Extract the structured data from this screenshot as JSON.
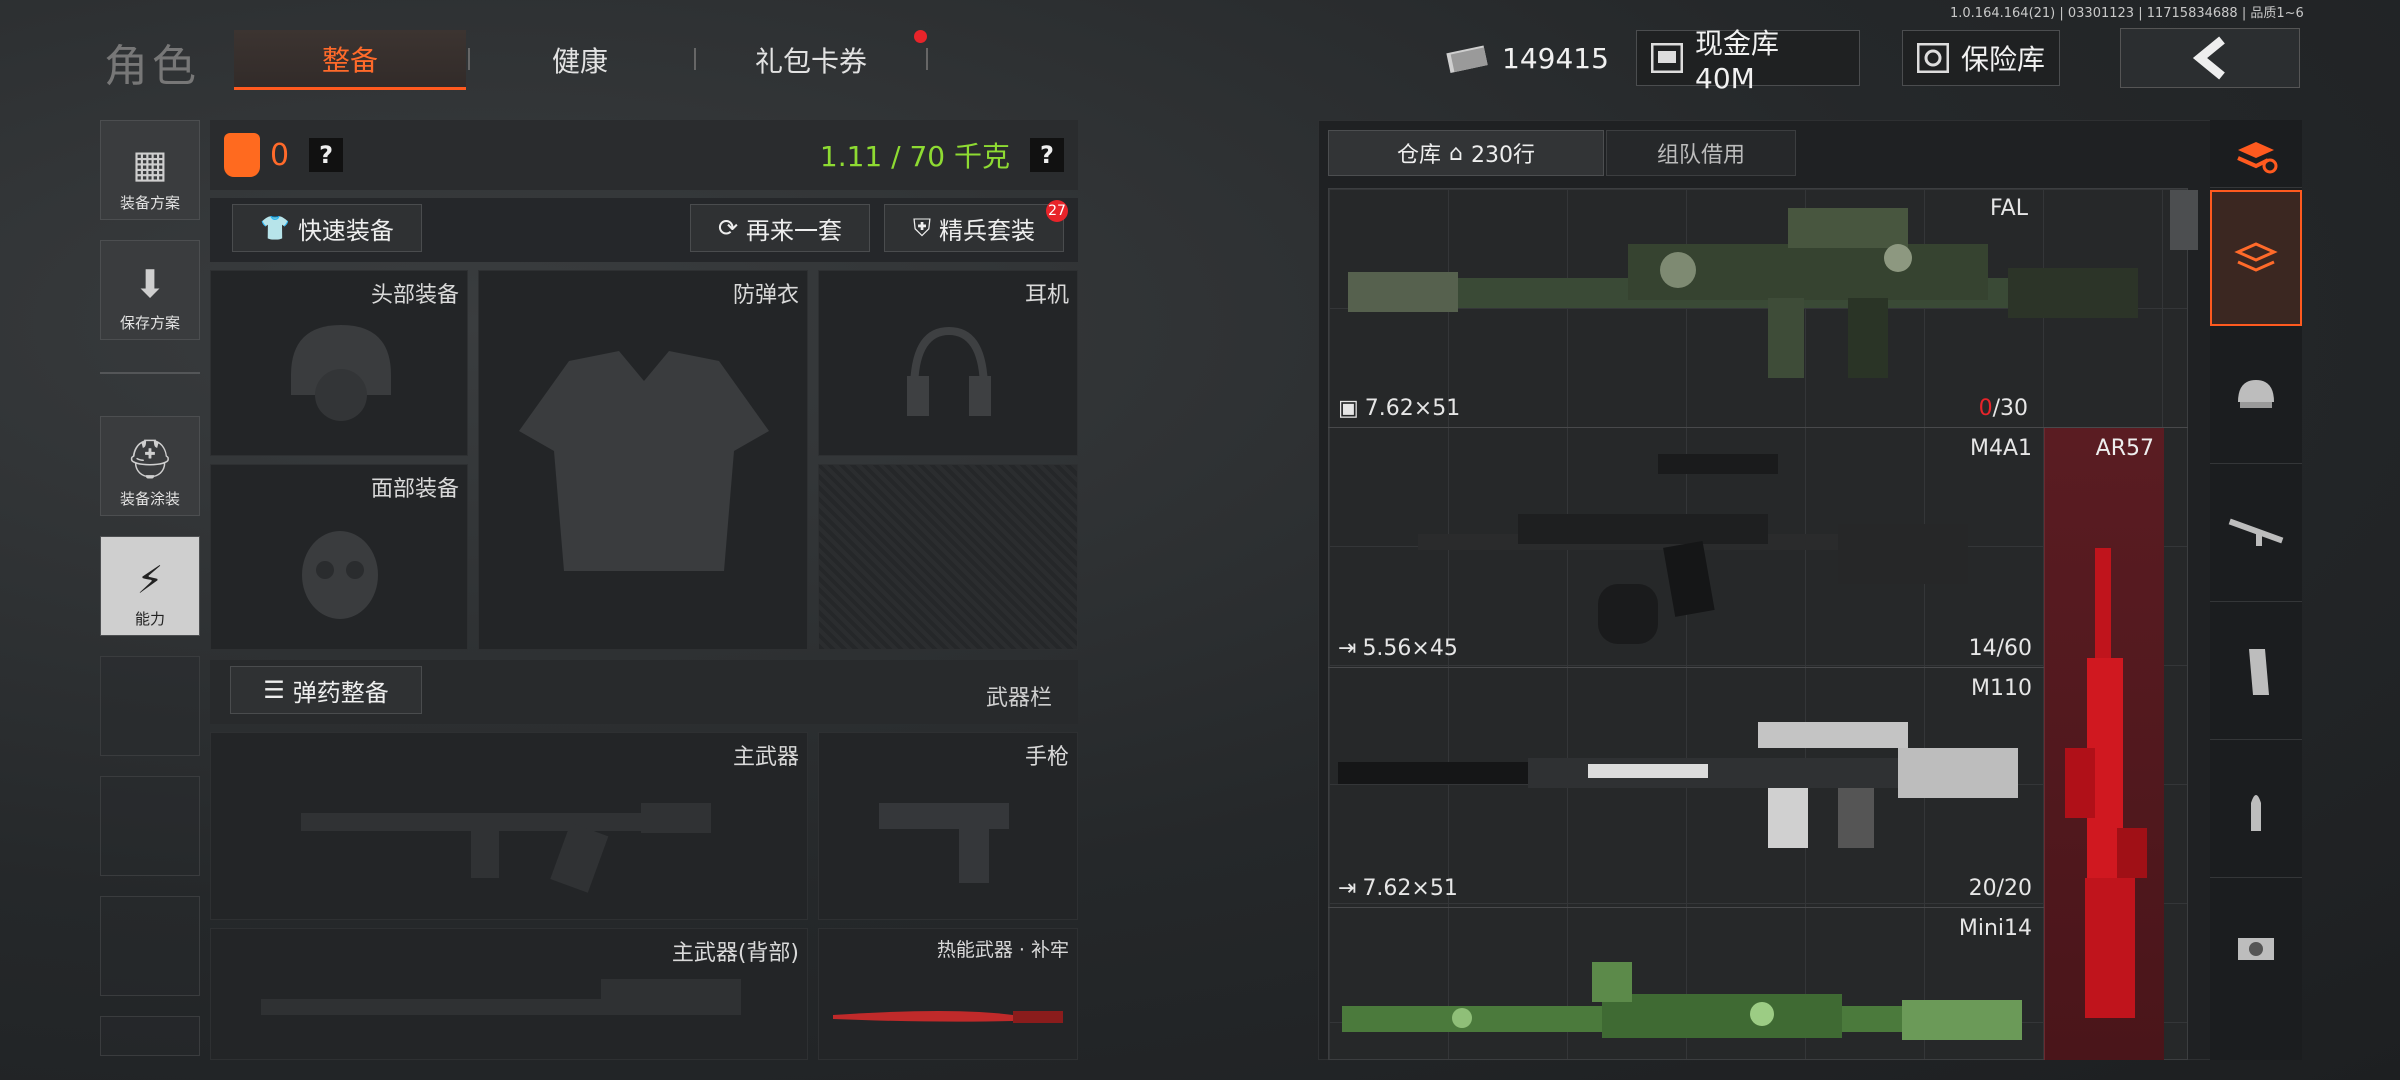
{
  "version": "1.0.164.164(21) | 03301123 | 11715834688 | 品质1~6",
  "header": {
    "title": "角色",
    "tabs": [
      {
        "label": "整备",
        "active": true
      },
      {
        "label": "健康"
      },
      {
        "label": "礼包卡券"
      }
    ],
    "money": "149415",
    "cash_vault": "现金库 40M",
    "insurance": "保险库",
    "back_icon": "‹"
  },
  "sidebar": {
    "items": [
      {
        "label": "装备方案",
        "icon": "vest-icon"
      },
      {
        "label": "保存方案",
        "icon": "download-icon"
      },
      {
        "label": "装备涂装",
        "icon": "helmet-icon"
      },
      {
        "label": "能力",
        "icon": "lightning-icon"
      }
    ]
  },
  "loadout": {
    "count": "0",
    "help": "?",
    "weight": "1.11 / 70 千克",
    "quick_equip": "快速装备",
    "again": "再来一套",
    "elite_set": "精兵套装",
    "elite_badge": "27",
    "slots": {
      "head": "头部装备",
      "armor": "防弹衣",
      "headset": "耳机",
      "face": "面部装备"
    },
    "ammo_equip": "弹药整备",
    "weapon_bar": "武器栏",
    "primary": "主武器",
    "pistol": "手枪",
    "primary_back": "主武器(背部)",
    "melee": "热能武器 · 补牢"
  },
  "warehouse": {
    "tab_label": "仓库",
    "rows": "230行",
    "team_borrow": "组队借用",
    "weapons": [
      {
        "name": "FAL",
        "caliber": "7.62×51",
        "ammo_current": "0",
        "ammo_max": "/30"
      },
      {
        "name": "M4A1",
        "caliber": "5.56×45",
        "ammo": "14/60"
      },
      {
        "name": "M110",
        "caliber": "7.62×51",
        "ammo": "20/20"
      },
      {
        "name": "Mini14"
      }
    ],
    "side_weapon": "AR57"
  },
  "colors": {
    "accent": "#ff5a1f",
    "weight_green": "#8edb32",
    "alert_red": "#e8242a"
  }
}
